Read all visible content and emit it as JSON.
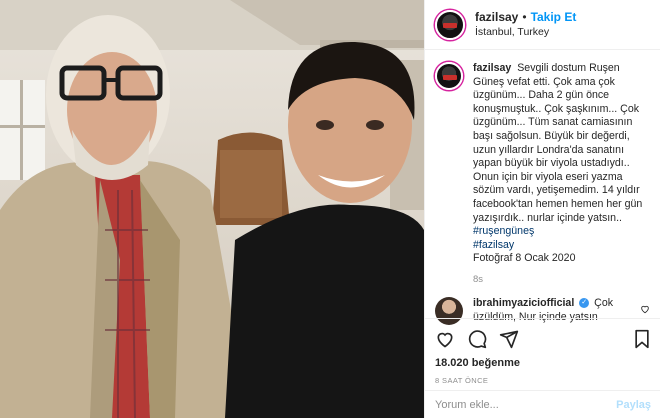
{
  "header": {
    "username": "fazilsay",
    "separator": "•",
    "follow_label": "Takip Et",
    "location": "İstanbul, Turkey"
  },
  "caption": {
    "username": "fazilsay",
    "text": "Sevgili dostum Ruşen Güneş vefat etti. Çok ama çok üzgünüm... Daha 2 gün önce konuşmuştuk.. Çok şaşkınım... Çok üzgünüm... Tüm sanat camiasının başı sağolsun. Büyük bir değerdi, uzun yıllardır Londra'da sanatını yapan büyük bir viyola ustadıydı.. Onun için bir viyola eseri yazma sözüm vardı, yetişemedim. 14 yıldır facebook'tan hemen hemen her gün yazışırdık.. nurlar içinde yatsın..",
    "hashtags": [
      "#ruşengüneş",
      "#fazilsay"
    ],
    "photo_note": "Fotoğraf 8 Ocak 2020",
    "time": "8s"
  },
  "comment": {
    "username": "ibrahimyaziciofficial",
    "verified_mark": "✓",
    "text": "Çok üzüldüm, Nur içinde yatsın"
  },
  "actions": {
    "likes": "18.020 beğenme",
    "post_time": "8 SAAT ÖNCE"
  },
  "add_comment": {
    "placeholder": "Yorum ekle...",
    "post_label": "Paylaş"
  },
  "icons": {
    "like": "heart-icon",
    "comment": "comment-icon",
    "share": "share-icon",
    "save": "bookmark-icon"
  },
  "colors": {
    "accent": "#0095f6",
    "tag": "#00376b",
    "muted": "#8e8e8e"
  }
}
